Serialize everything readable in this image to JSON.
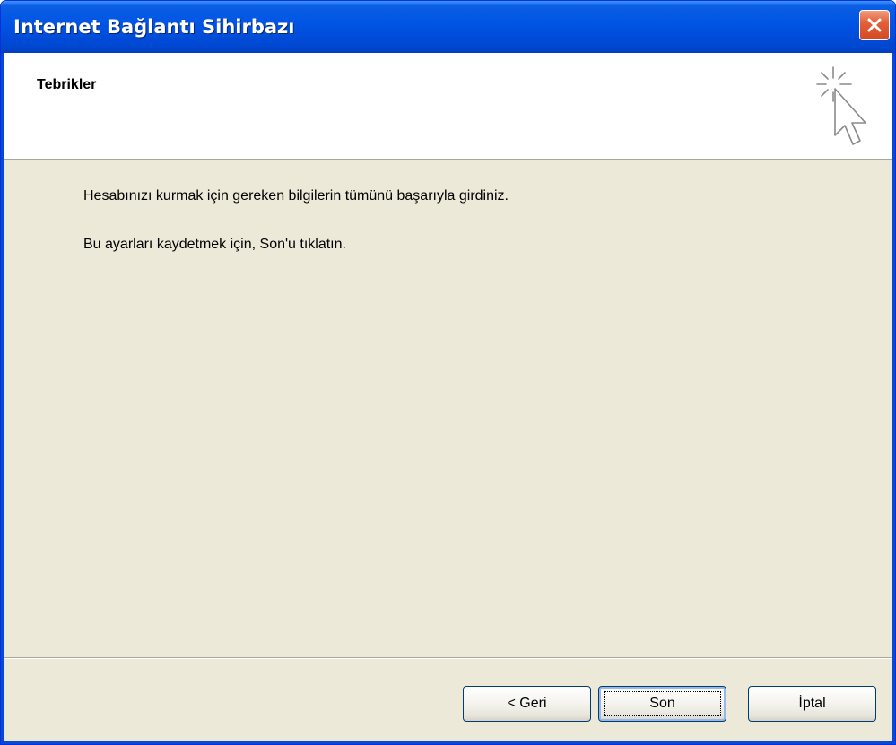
{
  "window": {
    "title": "Internet Bağlantı Sihirbazı"
  },
  "header": {
    "title": "Tebrikler",
    "icon": "wizard-cursor-icon"
  },
  "content": {
    "line1": "Hesabınızı kurmak için gereken bilgilerin tümünü başarıyla girdiniz.",
    "line2": "Bu ayarları kaydetmek için, Son'u tıklatın."
  },
  "buttons": {
    "back": "< Geri",
    "finish": "Son",
    "cancel": "İptal"
  },
  "colors": {
    "titlebar": "#0054e3",
    "close": "#d34a24",
    "dialog_bg": "#ece9d8"
  }
}
